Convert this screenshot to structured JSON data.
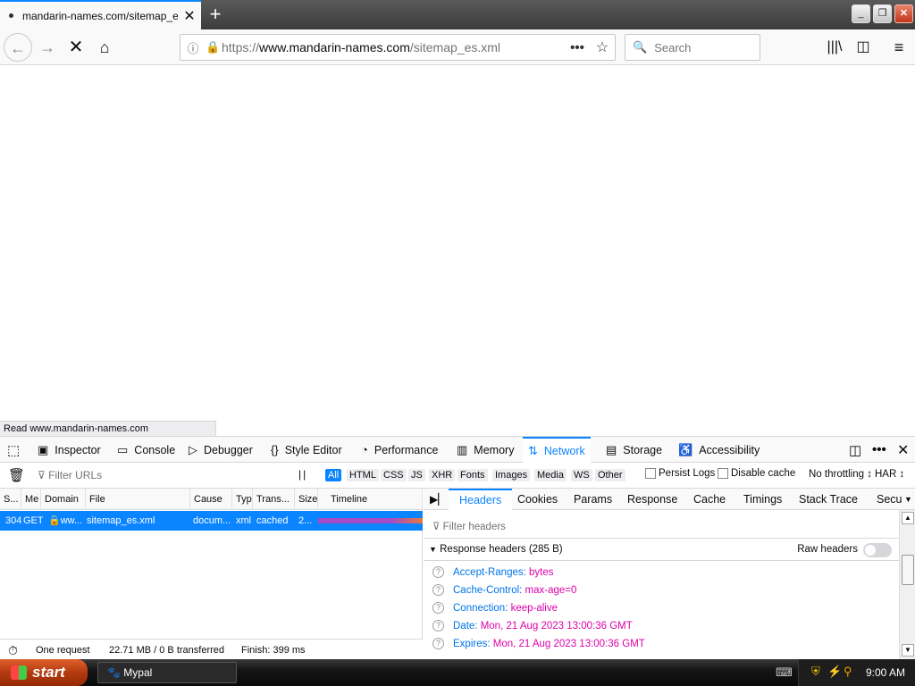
{
  "browser": {
    "tab_title": "mandarin-names.com/sitemap_es.",
    "url_scheme": "https://",
    "url_host": "www.mandarin-names.com",
    "url_path": "/sitemap_es.xml",
    "search_placeholder": "Search",
    "status_text": "Read www.mandarin-names.com"
  },
  "devtools": {
    "tabs": [
      {
        "label": "Inspector"
      },
      {
        "label": "Console"
      },
      {
        "label": "Debugger"
      },
      {
        "label": "Style Editor"
      },
      {
        "label": "Performance"
      },
      {
        "label": "Memory"
      },
      {
        "label": "Network"
      },
      {
        "label": "Storage"
      },
      {
        "label": "Accessibility"
      }
    ],
    "filter_urls_placeholder": "Filter URLs",
    "filter_types": [
      "All",
      "HTML",
      "CSS",
      "JS",
      "XHR",
      "Fonts",
      "Images",
      "Media",
      "WS",
      "Other"
    ],
    "persist_logs": "Persist Logs",
    "disable_cache": "Disable cache",
    "throttling": "No throttling ↕",
    "har": "HAR ↕",
    "columns": [
      "S...",
      "Me",
      "Domain",
      "File",
      "Cause",
      "Typ",
      "Trans...",
      "Size",
      "Timeline"
    ],
    "request": {
      "status": "304",
      "method": "GET",
      "domain": "ww...",
      "file": "sitemap_es.xml",
      "cause": "docum...",
      "type": "xml",
      "transferred": "cached",
      "size": "2..."
    },
    "summary": {
      "requests": "One request",
      "transferred": "22.71 MB / 0 B transferred",
      "finish": "Finish: 399 ms"
    },
    "side_tabs": [
      "Headers",
      "Cookies",
      "Params",
      "Response",
      "Cache",
      "Timings",
      "Stack Trace",
      "Secu"
    ],
    "filter_headers_placeholder": "Filter headers",
    "response_headers_title": "Response headers (285 B)",
    "raw_headers_label": "Raw headers",
    "headers": [
      {
        "key": "Accept-Ranges:",
        "value": "bytes"
      },
      {
        "key": "Cache-Control:",
        "value": "max-age=0"
      },
      {
        "key": "Connection:",
        "value": "keep-alive"
      },
      {
        "key": "Date:",
        "value": "Mon, 21 Aug 2023 13:00:36 GMT"
      },
      {
        "key": "Expires:",
        "value": "Mon, 21 Aug 2023 13:00:36 GMT"
      }
    ]
  },
  "taskbar": {
    "start_label": "start",
    "task_label": "Mypal",
    "clock": "9:00 AM"
  }
}
